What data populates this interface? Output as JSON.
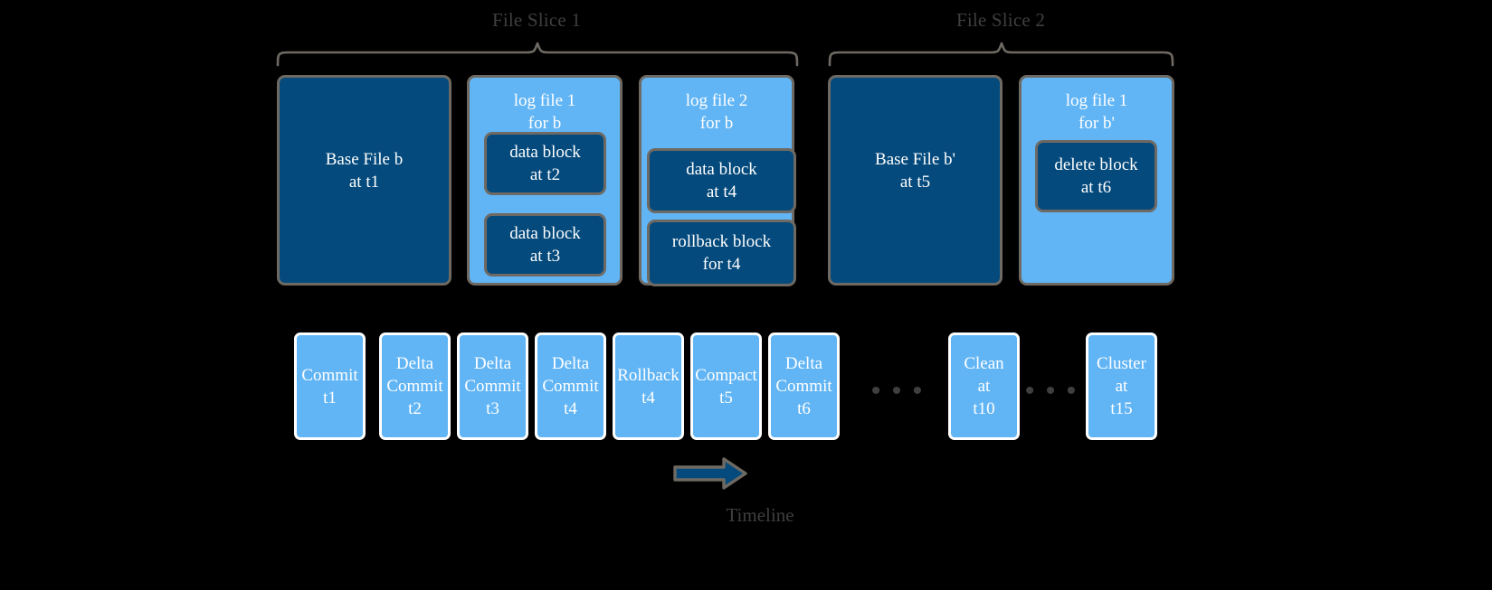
{
  "diagram": {
    "background_color": "#000000",
    "dark_blue": "#054a7c",
    "light_blue": "#62b5f5",
    "border_gray": "#6e6a63",
    "label_gray": "#3f3f3f",
    "timeline_border": "#ffffff"
  },
  "slices": [
    {
      "label": "File Slice 1"
    },
    {
      "label": "File Slice 2"
    }
  ],
  "file_boxes": [
    {
      "name": "base-file-b",
      "kind": "dark",
      "text": "Base File b\nat t1"
    },
    {
      "name": "log-file-1-for-b",
      "kind": "light",
      "title": "log file 1\nfor b"
    },
    {
      "name": "log-file-2-for-b",
      "kind": "light",
      "title": "log file 2\nfor b"
    },
    {
      "name": "base-file-b-prime",
      "kind": "dark",
      "text": "Base File b'\nat t5"
    },
    {
      "name": "log-file-1-for-b-prime",
      "kind": "light",
      "title": "log file 1\nfor b'"
    }
  ],
  "blocks": [
    {
      "name": "data-block-t2",
      "text": "data block\nat t2"
    },
    {
      "name": "data-block-t3",
      "text": "data block\nat t3"
    },
    {
      "name": "data-block-t4",
      "text": "data block\nat t4"
    },
    {
      "name": "rollback-block-t4",
      "text": "rollback block\nfor t4"
    },
    {
      "name": "delete-block-t6",
      "text": "delete block\nat t6"
    }
  ],
  "timeline": {
    "label": "Timeline",
    "ellipsis": "• • •",
    "items": [
      {
        "name": "commit-t1",
        "text": "Commit\nt1"
      },
      {
        "name": "delta-commit-t2",
        "text": "Delta\nCommit\nt2"
      },
      {
        "name": "delta-commit-t3",
        "text": "Delta\nCommit\nt3"
      },
      {
        "name": "delta-commit-t4",
        "text": "Delta\nCommit\nt4"
      },
      {
        "name": "rollback-t4",
        "text": "Rollback\nt4"
      },
      {
        "name": "compact-t5",
        "text": "Compact\nt5"
      },
      {
        "name": "delta-commit-t6",
        "text": "Delta\nCommit\nt6"
      },
      {
        "name": "clean-t10",
        "text": "Clean\nat\nt10"
      },
      {
        "name": "cluster-t15",
        "text": "Cluster\nat\nt15"
      }
    ]
  }
}
